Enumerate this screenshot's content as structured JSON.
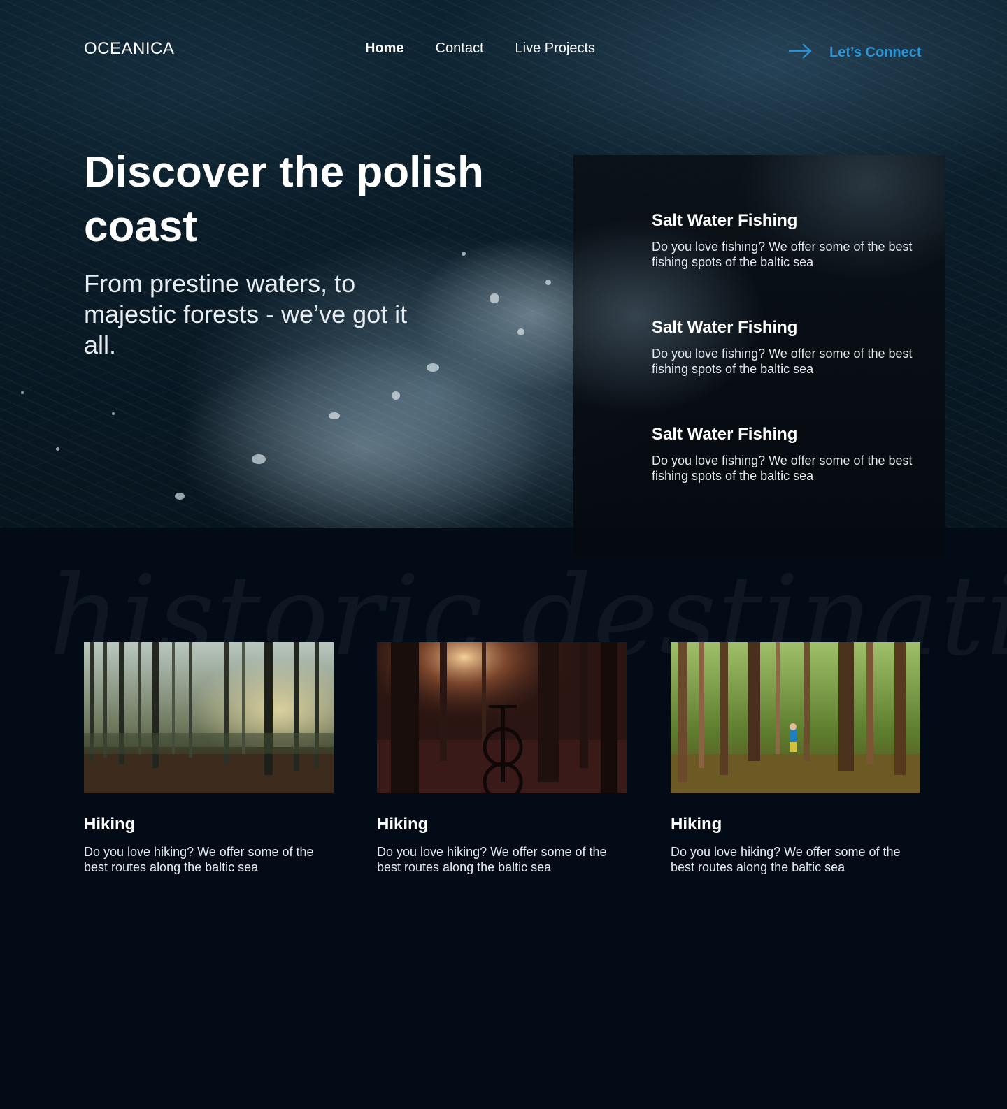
{
  "brand": {
    "logo_text": "OCEANICA"
  },
  "nav": {
    "links": [
      {
        "label": "Home",
        "active": true
      },
      {
        "label": "Contact",
        "active": false
      },
      {
        "label": "Live Projects",
        "active": false
      }
    ],
    "cta": {
      "label": "Let’s Connect",
      "icon": "arrow-right-icon",
      "color": "#2a93d5"
    }
  },
  "hero": {
    "title": "Discover the polish coast",
    "subtitle": "From prestine waters, to majestic forests - we’ve got it all."
  },
  "features": [
    {
      "title": "Salt Water Fishing",
      "description": "Do you love fishing? We offer some of the best fishing spots of the baltic sea"
    },
    {
      "title": "Salt Water Fishing",
      "description": "Do you love fishing? We offer some of the best fishing spots of the baltic sea"
    },
    {
      "title": "Salt Water Fishing",
      "description": "Do you love fishing? We offer some of the best fishing spots of the baltic sea"
    }
  ],
  "section": {
    "watermark": "historic destinations"
  },
  "cards": [
    {
      "title": "Hiking",
      "description": "Do you love hiking? We offer some of the best routes along the baltic sea"
    },
    {
      "title": "Hiking",
      "description": "Do you love hiking? We offer some of the best routes along the baltic sea"
    },
    {
      "title": "Hiking",
      "description": "Do you love hiking? We offer some of the best routes along the baltic sea"
    }
  ],
  "colors": {
    "page_background": "#020b16",
    "accent": "#2a93d5",
    "text": "#ffffff"
  }
}
